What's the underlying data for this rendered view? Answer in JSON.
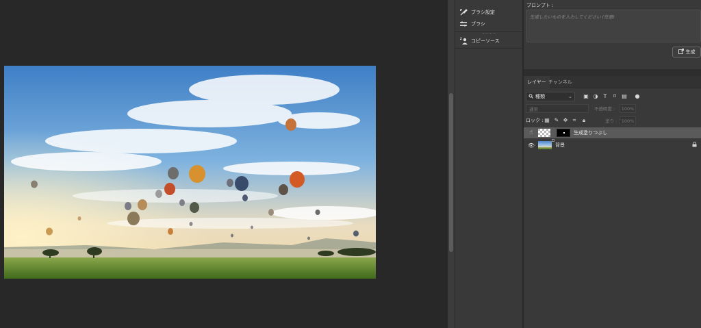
{
  "dock": {
    "items": [
      {
        "label": "ブラシ設定",
        "icon": "brush-settings-icon"
      },
      {
        "label": "ブラシ",
        "icon": "brush-icon"
      },
      {
        "label": "コピーソース",
        "icon": "clone-source-icon"
      }
    ]
  },
  "prompt": {
    "label": "プロンプト :",
    "placeholder": "生成したいものを入力してください (任意)",
    "generate_label": "生成"
  },
  "layers_panel": {
    "tabs": [
      "レイヤー",
      "チャンネル"
    ],
    "active_tab": 0,
    "kind_filter": "種類",
    "blend_mode": "通常",
    "opacity_label": "不透明度 :",
    "opacity_value": "100%",
    "lock_label": "ロック :",
    "fill_label": "塗り :",
    "fill_value": "100%",
    "layers": [
      {
        "name": "生成塗りつぶし",
        "visible": false,
        "selected": true,
        "locked": false
      },
      {
        "name": "背景",
        "visible": true,
        "selected": false,
        "locked": true
      }
    ]
  },
  "colors": {
    "workspace": "#282828",
    "panel": "#393939",
    "selected_layer": "#5a5a5a"
  }
}
